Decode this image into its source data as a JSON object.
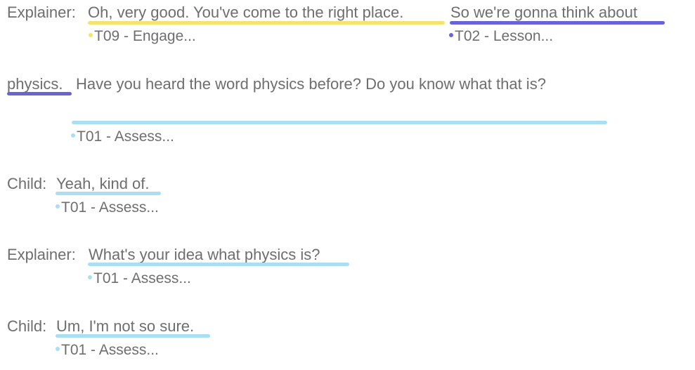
{
  "colors": {
    "T09": "#f5e46b",
    "T02": "#6a63d6",
    "T01": "#a9def3",
    "text": "#6e6e6e"
  },
  "turns": [
    {
      "speaker": "Explainer:",
      "segments": [
        {
          "text": "Oh, very good. You've come to the right place.",
          "code": "T09 - Engage..."
        },
        {
          "text": "So we're gonna think about",
          "code": "T02 - Lesson..."
        }
      ],
      "continuation": [
        {
          "text": "physics.",
          "code": "T02"
        },
        {
          "text": "Have you heard the word physics before? Do you know what that is?",
          "code": "T01 - Assess..."
        }
      ]
    },
    {
      "speaker": "Child:",
      "segments": [
        {
          "text": "Yeah, kind of.",
          "code": "T01 - Assess..."
        }
      ]
    },
    {
      "speaker": "Explainer:",
      "segments": [
        {
          "text": "What's your idea what physics is?",
          "code": "T01 - Assess..."
        }
      ]
    },
    {
      "speaker": "Child:",
      "segments": [
        {
          "text": "Um, I'm not so sure.",
          "code": "T01 - Assess..."
        }
      ]
    }
  ]
}
